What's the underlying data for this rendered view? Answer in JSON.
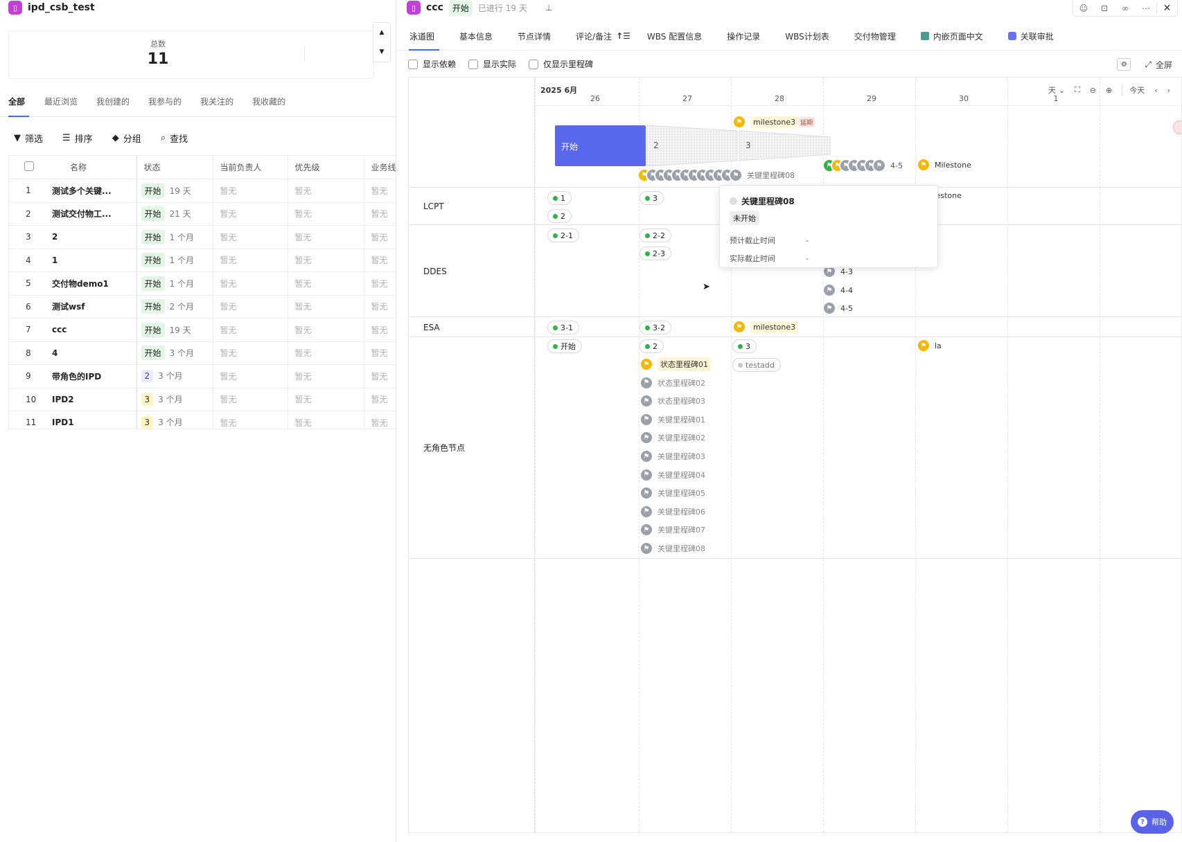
{
  "left": {
    "title": "ipd_csb_test",
    "total_label": "总数",
    "total_value": "11",
    "tabs": [
      "全部",
      "最近浏览",
      "我创建的",
      "我参与的",
      "我关注的",
      "我收藏的"
    ],
    "toolbar": {
      "filter": "筛选",
      "sort": "排序",
      "group": "分组",
      "find": "查找"
    },
    "columns": [
      "名称",
      "状态",
      "当前负责人",
      "优先级",
      "业务线"
    ],
    "rows": [
      {
        "no": "1",
        "name": "测试多个关键...",
        "status": "开始",
        "dur": "19 天",
        "owner": "暂无",
        "prio": "暂无",
        "line": "暂无",
        "kind": "green"
      },
      {
        "no": "2",
        "name": "测试交付物工...",
        "status": "开始",
        "dur": "21 天",
        "owner": "暂无",
        "prio": "暂无",
        "line": "暂无",
        "kind": "green"
      },
      {
        "no": "3",
        "name": "2",
        "status": "开始",
        "dur": "1 个月",
        "owner": "暂无",
        "prio": "暂无",
        "line": "暂无",
        "kind": "green"
      },
      {
        "no": "4",
        "name": "1",
        "status": "开始",
        "dur": "1 个月",
        "owner": "暂无",
        "prio": "暂无",
        "line": "暂无",
        "kind": "green"
      },
      {
        "no": "5",
        "name": "交付物demo1",
        "status": "开始",
        "dur": "1 个月",
        "owner": "暂无",
        "prio": "暂无",
        "line": "暂无",
        "kind": "green"
      },
      {
        "no": "6",
        "name": "测试wsf",
        "status": "开始",
        "dur": "2 个月",
        "owner": "暂无",
        "prio": "暂无",
        "line": "暂无",
        "kind": "green"
      },
      {
        "no": "7",
        "name": "ccc",
        "status": "开始",
        "dur": "19 天",
        "owner": "暂无",
        "prio": "暂无",
        "line": "暂无",
        "kind": "green"
      },
      {
        "no": "8",
        "name": "4",
        "status": "开始",
        "dur": "3 个月",
        "owner": "暂无",
        "prio": "暂无",
        "line": "暂无",
        "kind": "green"
      },
      {
        "no": "9",
        "name": "带角色的IPD",
        "status": "2",
        "dur": "3 个月",
        "owner": "暂无",
        "prio": "暂无",
        "line": "暂无",
        "kind": "blue"
      },
      {
        "no": "10",
        "name": "IPD2",
        "status": "3",
        "dur": "3 个月",
        "owner": "暂无",
        "prio": "暂无",
        "line": "暂无",
        "kind": "yellow"
      },
      {
        "no": "11",
        "name": "IPD1",
        "status": "3",
        "dur": "3 个月",
        "owner": "暂无",
        "prio": "暂无",
        "line": "暂无",
        "kind": "yellow"
      }
    ]
  },
  "right": {
    "title": "ccc",
    "status": "开始",
    "elapsed": "已进行 19 天",
    "tabs": [
      "泳道图",
      "基本信息",
      "节点详情",
      "评论/备注",
      "WBS 配置信息",
      "操作记录",
      "WBS计划表",
      "交付物管理",
      "内嵌页面中文",
      "关联审批"
    ],
    "checks": [
      "显示依赖",
      "显示实际",
      "仅显示里程碑"
    ],
    "fullscreen": "全屏",
    "month": "2025 6月",
    "days": [
      "26",
      "27",
      "28",
      "29",
      "30",
      "1"
    ],
    "unit": "天",
    "today": "今天",
    "lanes": [
      "LCPT",
      "DDES",
      "ESA",
      "无角色节点"
    ],
    "phases": [
      "开始",
      "2",
      "3"
    ],
    "top_milestone": "milestone3",
    "delay_badge": "延期",
    "top_right_milestone": "Milestone",
    "group_45_label": "4-5",
    "group_08_label": "关键里程碑08",
    "lcpt_nodes": [
      "1",
      "3",
      "2"
    ],
    "lcpt_milestone": "Milestone",
    "ddes_nodes": [
      "2-1",
      "2-2",
      "2-3"
    ],
    "ddes_flags": [
      "4-3",
      "4-4",
      "4-5"
    ],
    "esa_nodes": [
      "3-1",
      "3-2"
    ],
    "esa_milestone": "milestone3",
    "nr_nodes": [
      "开始",
      "2",
      "3"
    ],
    "nr_la": "la",
    "nr_testadd": "testadd",
    "nr_flags": [
      "状态里程碑01",
      "状态里程碑02",
      "状态里程碑03",
      "关键里程碑01",
      "关键里程碑02",
      "关键里程碑03",
      "关键里程碑04",
      "关键里程碑05",
      "关键里程碑06",
      "关键里程碑07",
      "关键里程碑08"
    ],
    "tooltip": {
      "title": "关键里程碑08",
      "status": "未开始",
      "k1": "预计截止时间",
      "v1": "-",
      "k2": "实际截止时间",
      "v2": "-"
    },
    "help": "帮助"
  }
}
